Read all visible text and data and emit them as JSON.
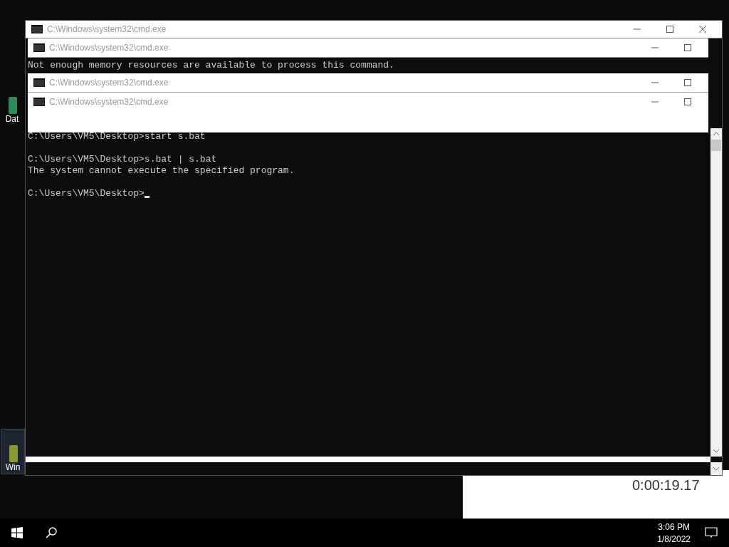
{
  "desktop": {
    "icons": [
      {
        "label": "Dat"
      },
      {
        "label": "Win"
      }
    ],
    "widget": {
      "time": "0:00:19.17"
    }
  },
  "windows": [
    {
      "kind": "main",
      "title": "C:\\Windows\\system32\\cmd.exe"
    },
    {
      "kind": "stacked",
      "title": "C:\\Windows\\system32\\cmd.exe",
      "output": "Not enough memory resources are available to process this command."
    },
    {
      "kind": "stacked",
      "title": "C:\\Windows\\system32\\cmd.exe"
    },
    {
      "kind": "stacked",
      "title": "C:\\Windows\\system32\\cmd.exe"
    }
  ],
  "console": {
    "blocks": [
      {
        "lines": [
          "C:\\Users\\VM5\\Desktop>start s.bat"
        ]
      },
      {
        "lines": [
          "C:\\Users\\VM5\\Desktop>s.bat | s.bat",
          "The system cannot execute the specified program."
        ]
      },
      {
        "lines": [
          "C:\\Users\\VM5\\Desktop>"
        ]
      }
    ]
  },
  "taskbar": {
    "time": "3:06 PM",
    "date": "1/8/2022"
  }
}
